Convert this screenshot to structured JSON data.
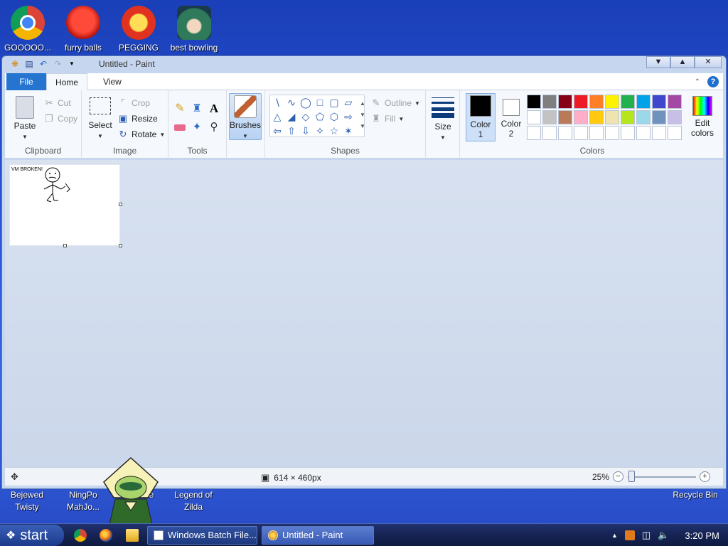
{
  "desktop": {
    "top_icons": [
      {
        "label": "GOOOOO..."
      },
      {
        "label": "furry balls"
      },
      {
        "label": "PEGGING"
      },
      {
        "label": "best bowling"
      }
    ],
    "bottom_icons": [
      {
        "line1": "Bejewed",
        "line2": "Twisty"
      },
      {
        "line1": "NingPo",
        "line2": "MahJo..."
      },
      {
        "line1": "...xe",
        "line2": ""
      },
      {
        "line1": "Legend of",
        "line2": "Zilda"
      },
      {
        "line1": "Recycle Bin",
        "line2": ""
      }
    ]
  },
  "window": {
    "title": "Untitled - Paint",
    "tabs": {
      "file": "File",
      "home": "Home",
      "view": "View"
    },
    "clipboard": {
      "title": "Clipboard",
      "paste": "Paste",
      "cut": "Cut",
      "copy": "Copy"
    },
    "image": {
      "title": "Image",
      "select": "Select",
      "crop": "Crop",
      "resize": "Resize",
      "rotate": "Rotate"
    },
    "tools": {
      "title": "Tools"
    },
    "brushes": {
      "label": "Brushes"
    },
    "shapes": {
      "title": "Shapes",
      "outline": "Outline",
      "fill": "Fill"
    },
    "size": {
      "label": "Size"
    },
    "colors": {
      "title": "Colors",
      "color1_label": "Color",
      "color1_num": "1",
      "color2_label": "Color",
      "color2_num": "2",
      "edit_label": "Edit",
      "edit_label2": "colors",
      "color1": "#000000",
      "color2": "#ffffff",
      "palette_row1": [
        "#000000",
        "#7f7f7f",
        "#880015",
        "#ed1c24",
        "#ff7f27",
        "#fff200",
        "#22b14c",
        "#00a2e8",
        "#3f48cc",
        "#a349a4"
      ],
      "palette_row2": [
        "#ffffff",
        "#c3c3c3",
        "#b97a57",
        "#ffaec9",
        "#ffc90e",
        "#efe4b0",
        "#b5e61d",
        "#99d9ea",
        "#7092be",
        "#c8bfe7"
      ],
      "palette_row3": [
        "#ffffff",
        "#ffffff",
        "#ffffff",
        "#ffffff",
        "#ffffff",
        "#ffffff",
        "#ffffff",
        "#ffffff",
        "#ffffff",
        "#ffffff"
      ]
    },
    "canvas": {
      "drawing_text": "VM BROKEN!"
    },
    "status": {
      "dimensions": "614 × 460px",
      "zoom": "25%"
    }
  },
  "taskbar": {
    "start": "start",
    "buttons": [
      {
        "label": "Windows Batch File..."
      },
      {
        "label": "Untitled - Paint"
      }
    ],
    "clock": "3:20 PM"
  }
}
